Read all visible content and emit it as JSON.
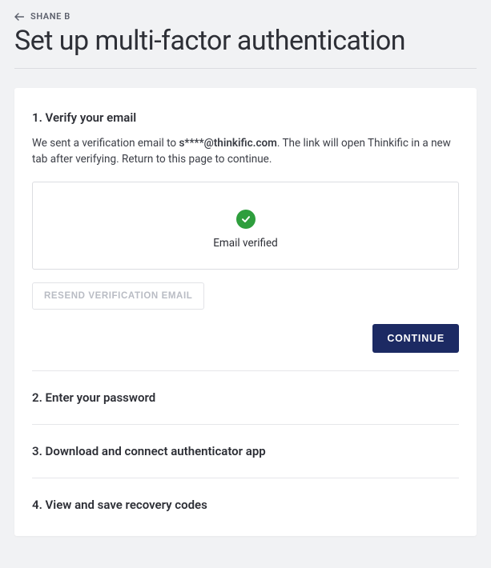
{
  "breadcrumb": {
    "label": "SHANE B"
  },
  "page": {
    "title": "Set up multi-factor authentication"
  },
  "step1": {
    "title": "1. Verify your email",
    "desc_prefix": "We sent a verification email to ",
    "email": "s****@thinkific.com",
    "desc_suffix": ". The link will open Thinkific in a new tab after verifying. Return to this page to continue.",
    "verified_label": "Email verified",
    "resend_label": "RESEND VERIFICATION EMAIL",
    "continue_label": "CONTINUE"
  },
  "step2": {
    "title": "2. Enter your password"
  },
  "step3": {
    "title": "3. Download and connect authenticator app"
  },
  "step4": {
    "title": "4. View and save recovery codes"
  }
}
